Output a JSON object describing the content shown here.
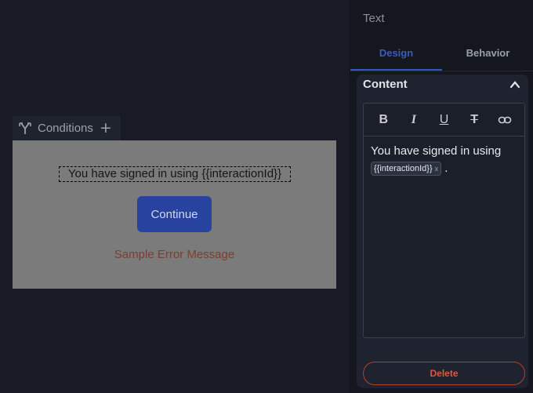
{
  "canvas": {
    "conditions_label": "Conditions",
    "add_symbol": "+",
    "preview_text": "You have signed in using {{interactionId}}",
    "continue_label": "Continue",
    "error_message": "Sample Error Message"
  },
  "panel": {
    "title": "Text",
    "tabs": [
      {
        "label": "Design",
        "active": true
      },
      {
        "label": "Behavior",
        "active": false
      }
    ],
    "content": {
      "header": "Content",
      "toolbar": {
        "bold": "B",
        "italic": "I",
        "underline": "U",
        "strike": "T",
        "link_icon": "link-icon"
      },
      "editor_text": "You have signed in using",
      "variable_chip": "{{interactionId}}",
      "chip_remove": "x",
      "trailing": "."
    },
    "delete_label": "Delete"
  },
  "colors": {
    "accent": "#3257c2",
    "danger": "#d65b41",
    "preview_bg": "#7b7b7b"
  }
}
